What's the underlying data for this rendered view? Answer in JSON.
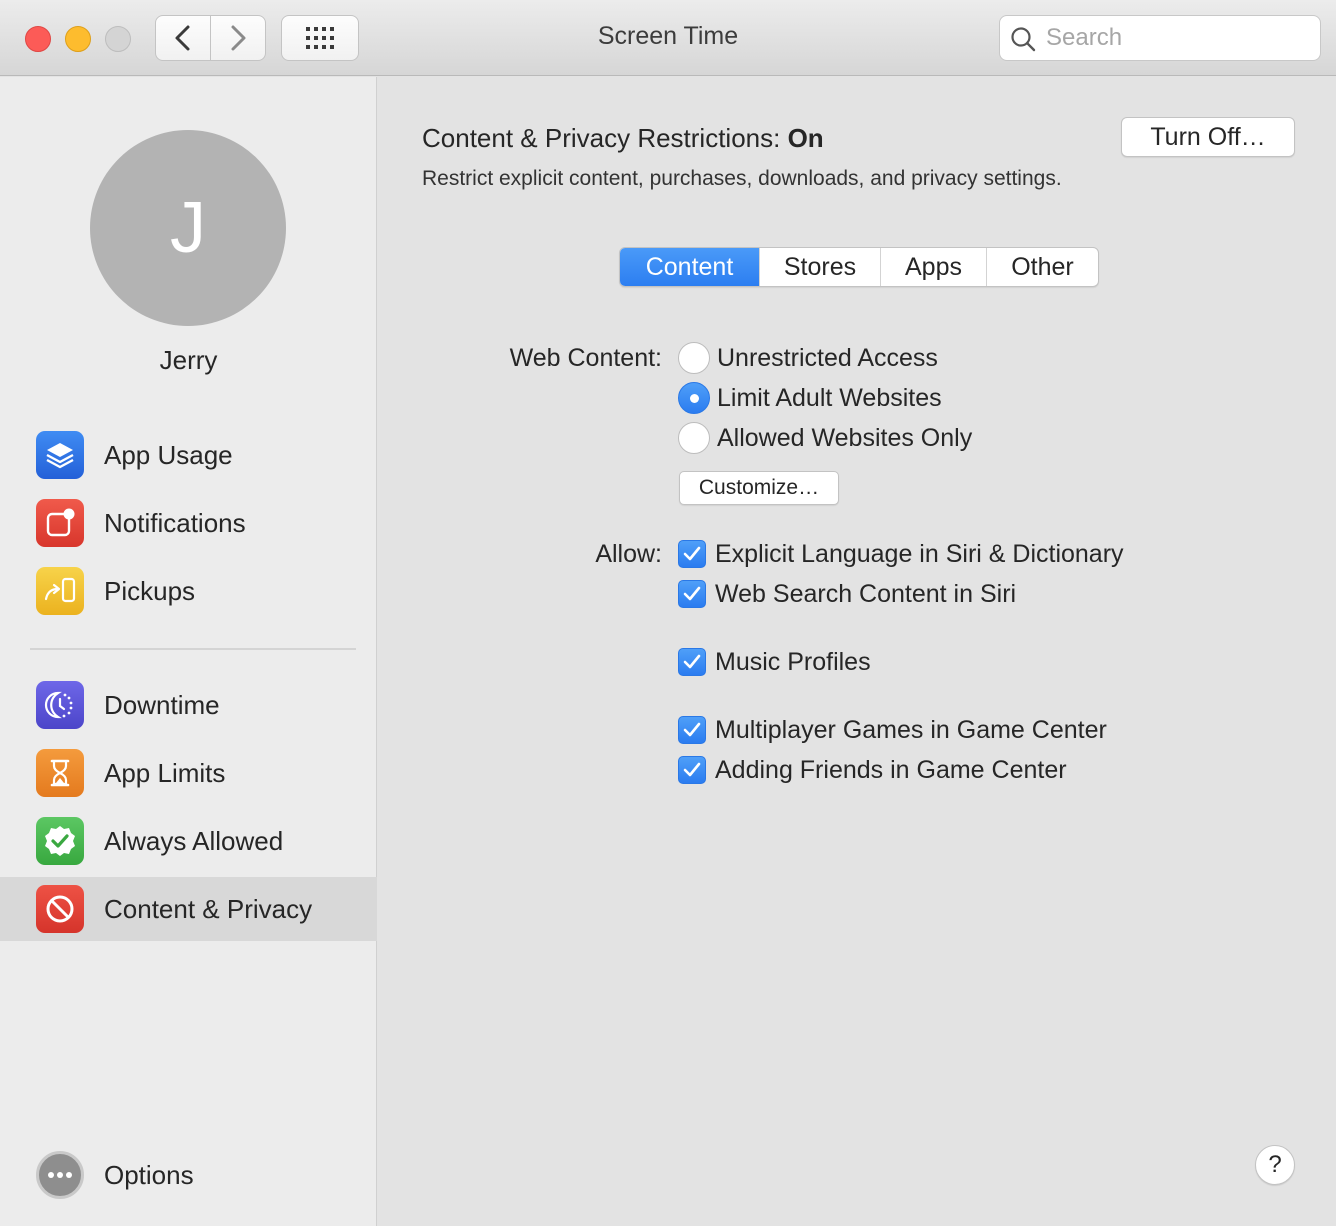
{
  "window": {
    "title": "Screen Time",
    "search_placeholder": "Search"
  },
  "sidebar": {
    "user": {
      "initial": "J",
      "name": "Jerry"
    },
    "items": [
      {
        "label": "App Usage",
        "icon": "layers-icon",
        "color": "#2e6fe6"
      },
      {
        "label": "Notifications",
        "icon": "notification-badge-icon",
        "color": "#e5463a"
      },
      {
        "label": "Pickups",
        "icon": "pickup-phone-icon",
        "color": "#f2c230"
      },
      {
        "label": "Downtime",
        "icon": "moon-clock-icon",
        "color": "#5c55d8"
      },
      {
        "label": "App Limits",
        "icon": "hourglass-icon",
        "color": "#ee8a2a"
      },
      {
        "label": "Always Allowed",
        "icon": "checkmark-badge-icon",
        "color": "#48b84e"
      },
      {
        "label": "Content & Privacy",
        "icon": "no-entry-icon",
        "color": "#e1413a"
      }
    ],
    "selected": "Content & Privacy",
    "options_label": "Options"
  },
  "main": {
    "status_prefix": "Content & Privacy Restrictions: ",
    "status_value": "On",
    "turn_off_label": "Turn Off…",
    "description": "Restrict explicit content, purchases, downloads, and privacy settings.",
    "tabs": [
      {
        "label": "Content",
        "active": true
      },
      {
        "label": "Stores",
        "active": false
      },
      {
        "label": "Apps",
        "active": false
      },
      {
        "label": "Other",
        "active": false
      }
    ],
    "web_content": {
      "label": "Web Content:",
      "options": [
        {
          "label": "Unrestricted Access",
          "selected": false
        },
        {
          "label": "Limit Adult Websites",
          "selected": true
        },
        {
          "label": "Allowed Websites Only",
          "selected": false
        }
      ],
      "customize_label": "Customize…"
    },
    "allow": {
      "label": "Allow:",
      "items": [
        {
          "label": "Explicit Language in Siri & Dictionary",
          "checked": true
        },
        {
          "label": "Web Search Content in Siri",
          "checked": true
        },
        {
          "label": "Music Profiles",
          "checked": true
        },
        {
          "label": "Multiplayer Games in Game Center",
          "checked": true
        },
        {
          "label": "Adding Friends in Game Center",
          "checked": true
        }
      ]
    },
    "help_label": "?"
  },
  "colors": {
    "accent": "#2c7ef1",
    "close": "#fc5b57",
    "minimize": "#fdbc2e",
    "zoom": "#d4d4d4"
  }
}
